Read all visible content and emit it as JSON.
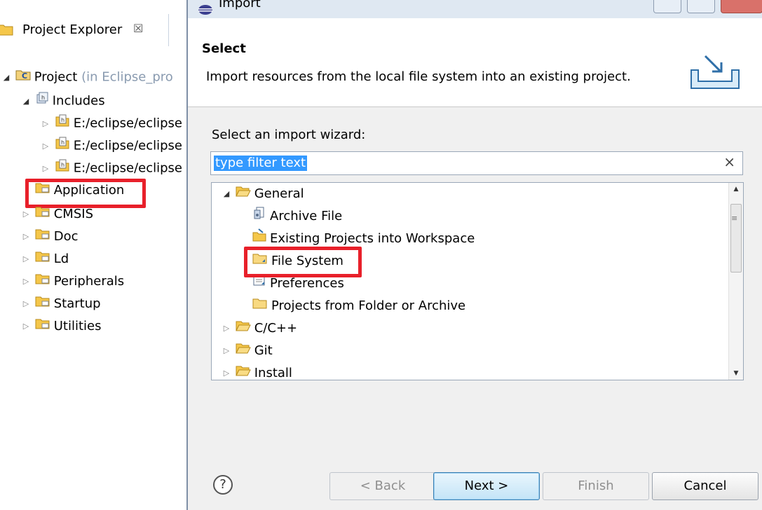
{
  "explorer": {
    "title": "Project Explorer",
    "close_glyph": "☒",
    "project": {
      "name": "Project",
      "location": "(in Eclipse_pro"
    },
    "includes": {
      "label": "Includes",
      "items": [
        "E:/eclipse/eclipse",
        "E:/eclipse/eclipse",
        "E:/eclipse/eclipse"
      ]
    },
    "folders": [
      "Application",
      "CMSIS",
      "Doc",
      "Ld",
      "Peripherals",
      "Startup",
      "Utilities"
    ],
    "highlighted_folder": "Application"
  },
  "dialog": {
    "title": "Import",
    "banner_title": "Select",
    "banner_description": "Import resources from the local file system into an existing project.",
    "wizard_label": "Select an import wizard:",
    "filter": {
      "value": "type filter text",
      "clear_glyph": "×"
    },
    "tree": {
      "general": "General",
      "general_items": [
        "Archive File",
        "Existing Projects into Workspace",
        "File System",
        "Preferences",
        "Projects from Folder or Archive"
      ],
      "categories": [
        "C/C++",
        "Git",
        "Install"
      ],
      "highlighted_item": "File System"
    },
    "buttons": {
      "help": "?",
      "back": "< Back",
      "next": "Next >",
      "finish": "Finish",
      "cancel": "Cancel"
    }
  },
  "colors": {
    "highlight": "#e8202a",
    "selection": "#3399ff",
    "folder": "#f5c74a"
  },
  "icons": [
    "project-explorer-icon",
    "project-icon",
    "includes-icon",
    "include-path-icon",
    "folder-icon",
    "archive-file-icon",
    "existing-projects-icon",
    "file-system-folder-icon",
    "preferences-icon",
    "import-banner-icon",
    "help-icon"
  ]
}
